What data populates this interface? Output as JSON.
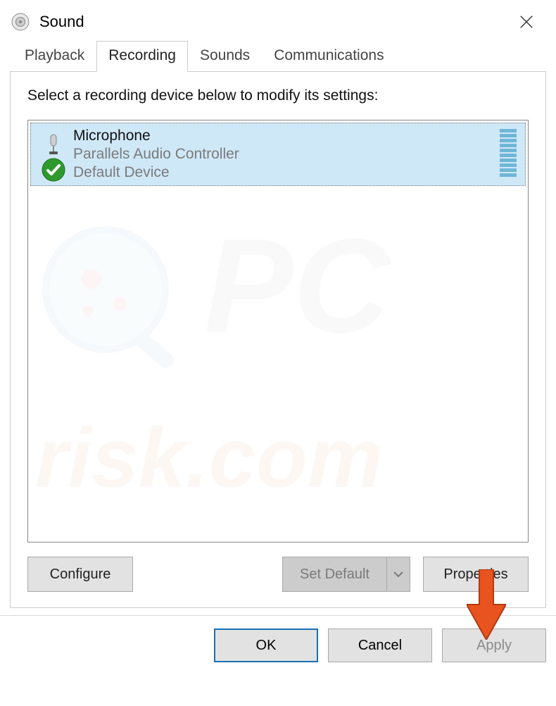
{
  "window": {
    "title": "Sound"
  },
  "tabs": [
    {
      "label": "Playback",
      "active": false
    },
    {
      "label": "Recording",
      "active": true
    },
    {
      "label": "Sounds",
      "active": false
    },
    {
      "label": "Communications",
      "active": false
    }
  ],
  "panel": {
    "instruction": "Select a recording device below to modify its settings:",
    "devices": [
      {
        "name": "Microphone",
        "description": "Parallels Audio Controller",
        "status": "Default Device",
        "selected": true,
        "default": true
      }
    ],
    "buttons": {
      "configure": "Configure",
      "set_default": "Set Default",
      "properties": "Properties"
    }
  },
  "dialog_buttons": {
    "ok": "OK",
    "cancel": "Cancel",
    "apply": "Apply"
  },
  "watermark_text": "PCrisk.com"
}
